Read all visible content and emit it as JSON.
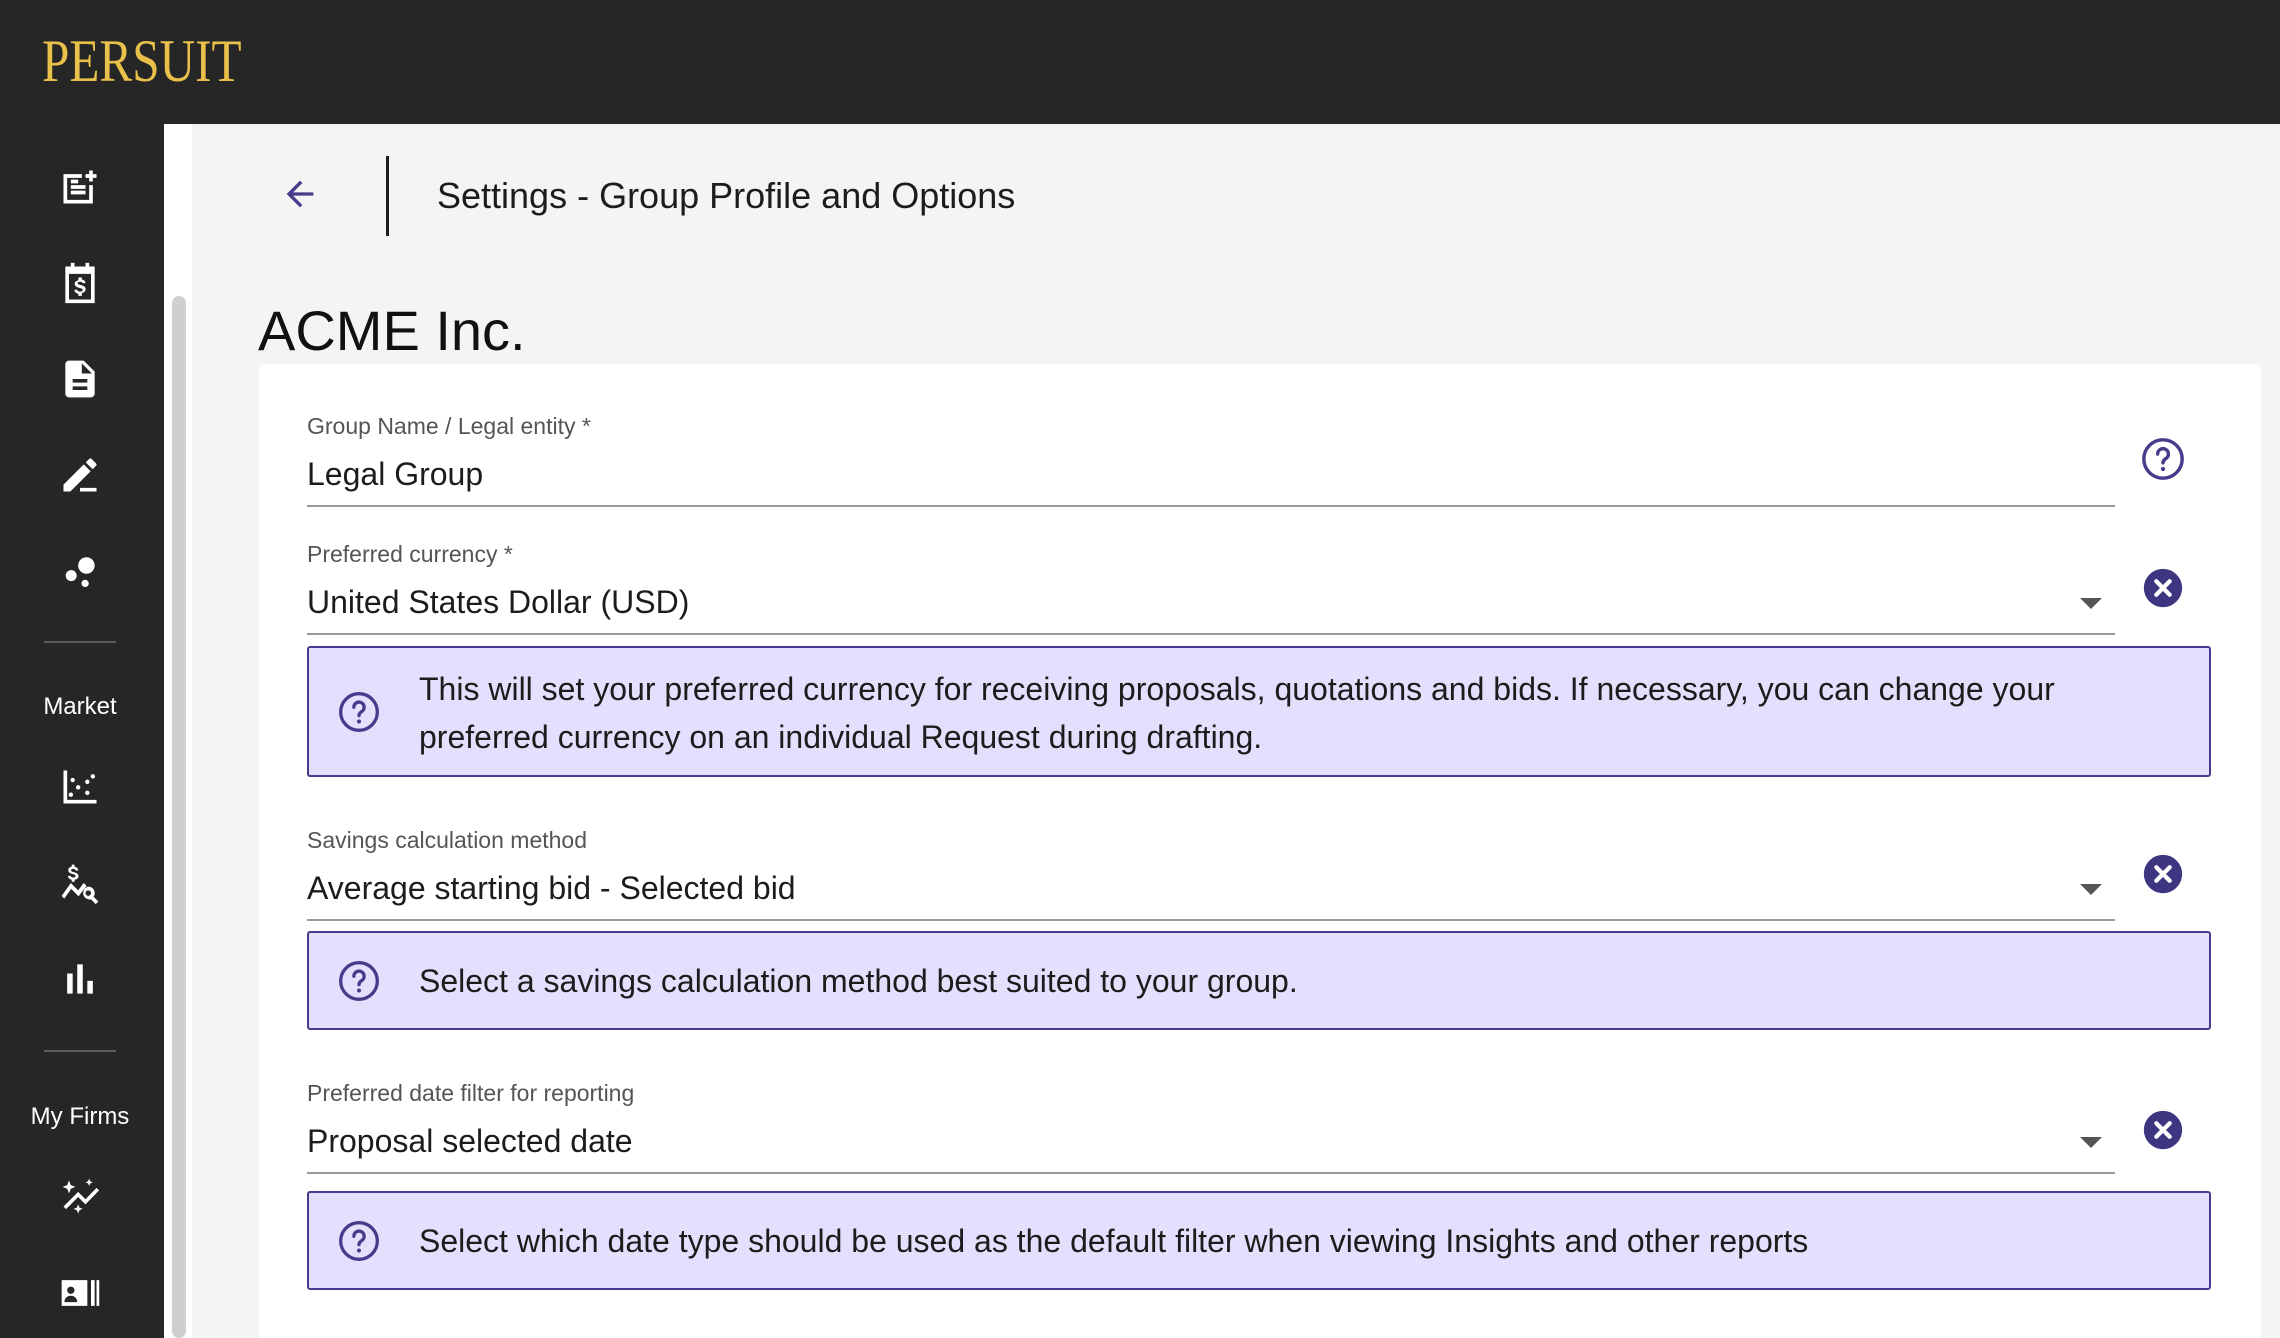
{
  "app": {
    "logo_text": "PERSUIT"
  },
  "sidebar": {
    "top_icons": [
      "new-request-icon",
      "billing-calendar-icon",
      "document-icon",
      "edit-icon",
      "bubbles-icon"
    ],
    "market_label": "Market",
    "market_icons": [
      "scatter-chart-icon",
      "price-search-icon",
      "bar-chart-icon"
    ],
    "my_firms_label": "My Firms",
    "my_firms_icons": [
      "insights-icon",
      "firm-card-icon"
    ]
  },
  "header": {
    "back_icon": "arrow-back-icon",
    "title": "Settings - Group Profile and Options"
  },
  "organization": {
    "name": "ACME Inc."
  },
  "form": {
    "group_name": {
      "label": "Group Name / Legal entity *",
      "value": "Legal Group",
      "help_icon": "help-circle-icon"
    },
    "preferred_currency": {
      "label": "Preferred currency *",
      "value": "United States Dollar (USD)",
      "clear_icon": "clear-circle-icon",
      "info_text": "This will set your preferred currency for receiving proposals, quotations and bids. If necessary, you can change your preferred currency on an individual Request during drafting."
    },
    "savings_method": {
      "label": "Savings calculation method",
      "value": "Average starting bid - Selected bid",
      "clear_icon": "clear-circle-icon",
      "info_text": "Select a savings calculation method best suited to your group."
    },
    "date_filter": {
      "label": "Preferred date filter for reporting",
      "value": "Proposal selected date",
      "clear_icon": "clear-circle-icon",
      "info_text": "Select which date type should be used as the default filter when viewing Insights and other reports"
    }
  },
  "colors": {
    "topbar": "#262626",
    "logo": "#e8c04a",
    "accent": "#4a3a8c",
    "info_bg": "#e5defc"
  }
}
